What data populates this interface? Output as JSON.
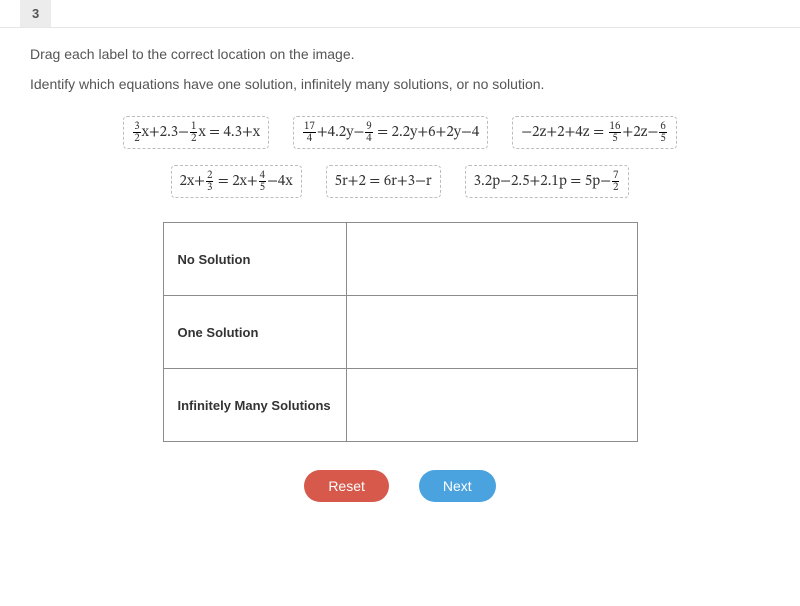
{
  "question_number": "3",
  "instruction_drag": "Drag each label to the correct location on the image.",
  "instruction_task": "Identify which equations have one solution, infinitely many solutions, or no solution.",
  "labels": {
    "row1": [
      {
        "id": "eq1",
        "parts": [
          {
            "type": "frac",
            "num": "3",
            "den": "2"
          },
          {
            "type": "txt",
            "v": "x+2.3−"
          },
          {
            "type": "frac",
            "num": "1",
            "den": "2"
          },
          {
            "type": "txt",
            "v": "x = 4.3+x"
          }
        ]
      },
      {
        "id": "eq2",
        "parts": [
          {
            "type": "frac",
            "num": "17",
            "den": "4"
          },
          {
            "type": "txt",
            "v": "+4.2y−"
          },
          {
            "type": "frac",
            "num": "9",
            "den": "4"
          },
          {
            "type": "txt",
            "v": " = 2.2y+6+2y−4"
          }
        ]
      },
      {
        "id": "eq3",
        "parts": [
          {
            "type": "txt",
            "v": "−2z+2+4z = "
          },
          {
            "type": "frac",
            "num": "16",
            "den": "5"
          },
          {
            "type": "txt",
            "v": "+2z−"
          },
          {
            "type": "frac",
            "num": "6",
            "den": "5"
          }
        ]
      }
    ],
    "row2": [
      {
        "id": "eq4",
        "parts": [
          {
            "type": "txt",
            "v": "2x+"
          },
          {
            "type": "frac",
            "num": "2",
            "den": "3"
          },
          {
            "type": "txt",
            "v": " = 2x+"
          },
          {
            "type": "frac",
            "num": "4",
            "den": "5"
          },
          {
            "type": "txt",
            "v": "−4x"
          }
        ]
      },
      {
        "id": "eq5",
        "parts": [
          {
            "type": "txt",
            "v": "5r+2 = 6r+3−r"
          }
        ]
      },
      {
        "id": "eq6",
        "parts": [
          {
            "type": "txt",
            "v": "3.2p−2.5+2.1p = 5p−"
          },
          {
            "type": "frac",
            "num": "7",
            "den": "2"
          }
        ]
      }
    ]
  },
  "categories": [
    "No Solution",
    "One Solution",
    "Infinitely Many Solutions"
  ],
  "buttons": {
    "reset": "Reset",
    "next": "Next"
  }
}
